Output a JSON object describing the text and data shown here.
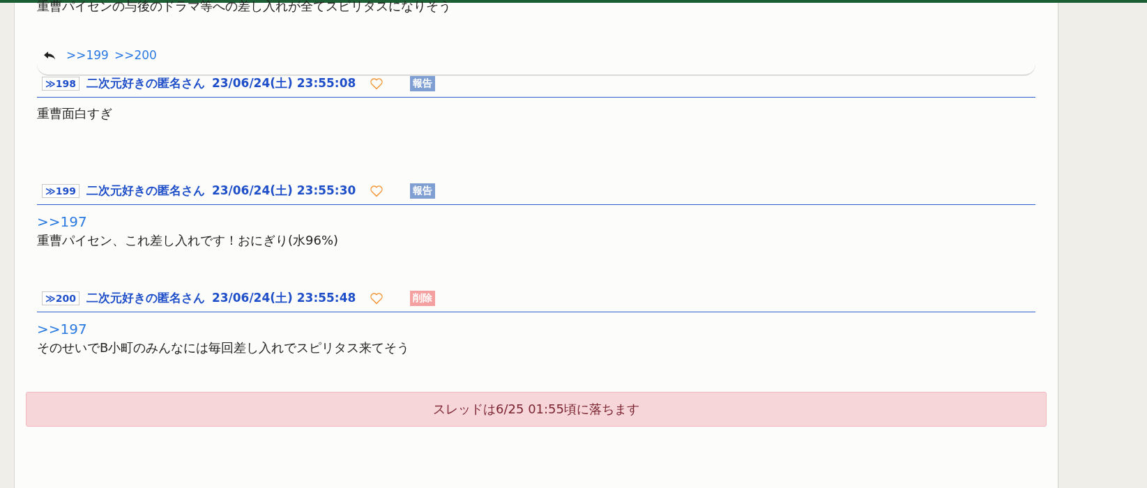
{
  "previous_post": {
    "body": "重曹パイセンの与後のドラマ等への差し入れが全てスピリタスになりそう",
    "replies": [
      ">>199",
      ">>200"
    ]
  },
  "posts": [
    {
      "number": "≫198",
      "name": "二次元好きの匿名さん",
      "date": "23/06/24(土) 23:55:08",
      "action": {
        "kind": "report",
        "label": "報告"
      },
      "body": "重曹面白すぎ"
    },
    {
      "number": "≫199",
      "name": "二次元好きの匿名さん",
      "date": "23/06/24(土) 23:55:30",
      "action": {
        "kind": "report",
        "label": "報告"
      },
      "anchor": ">>197",
      "body": "重曹パイセン、これ差し入れです！おにぎり(水96%)"
    },
    {
      "number": "≫200",
      "name": "二次元好きの匿名さん",
      "date": "23/06/24(土) 23:55:48",
      "action": {
        "kind": "delete",
        "label": "削除"
      },
      "anchor": ">>197",
      "body": "そのせいでB小町のみんなには毎回差し入れでスピリタス来てそう"
    }
  ],
  "notice": "スレッドは6/25 01:55頃に落ちます"
}
